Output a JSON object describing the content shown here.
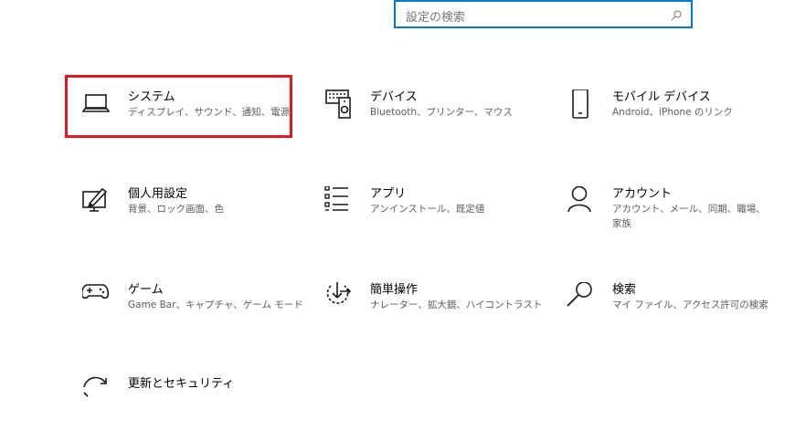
{
  "search": {
    "placeholder": "設定の検索"
  },
  "tiles": [
    {
      "title": "システム",
      "desc": "ディスプレイ、サウンド、通知、電源"
    },
    {
      "title": "デバイス",
      "desc": "Bluetooth、プリンター、マウス"
    },
    {
      "title": "モバイル デバイス",
      "desc": "Android、iPhone のリンク"
    },
    {
      "title": "個人用設定",
      "desc": "背景、ロック画面、色"
    },
    {
      "title": "アプリ",
      "desc": "アンインストール、既定値"
    },
    {
      "title": "アカウント",
      "desc": "アカウント、メール、同期、職場、家族"
    },
    {
      "title": "ゲーム",
      "desc": "Game Bar、キャプチャ、ゲーム モード"
    },
    {
      "title": "簡単操作",
      "desc": "ナレーター、拡大鏡、ハイコントラスト"
    },
    {
      "title": "検索",
      "desc": "マイ ファイル、アクセス許可の検索"
    },
    {
      "title": "更新とセキュリティ",
      "desc": ""
    }
  ],
  "colors": {
    "accent": "#0078d7",
    "highlight": "#e0181f"
  }
}
